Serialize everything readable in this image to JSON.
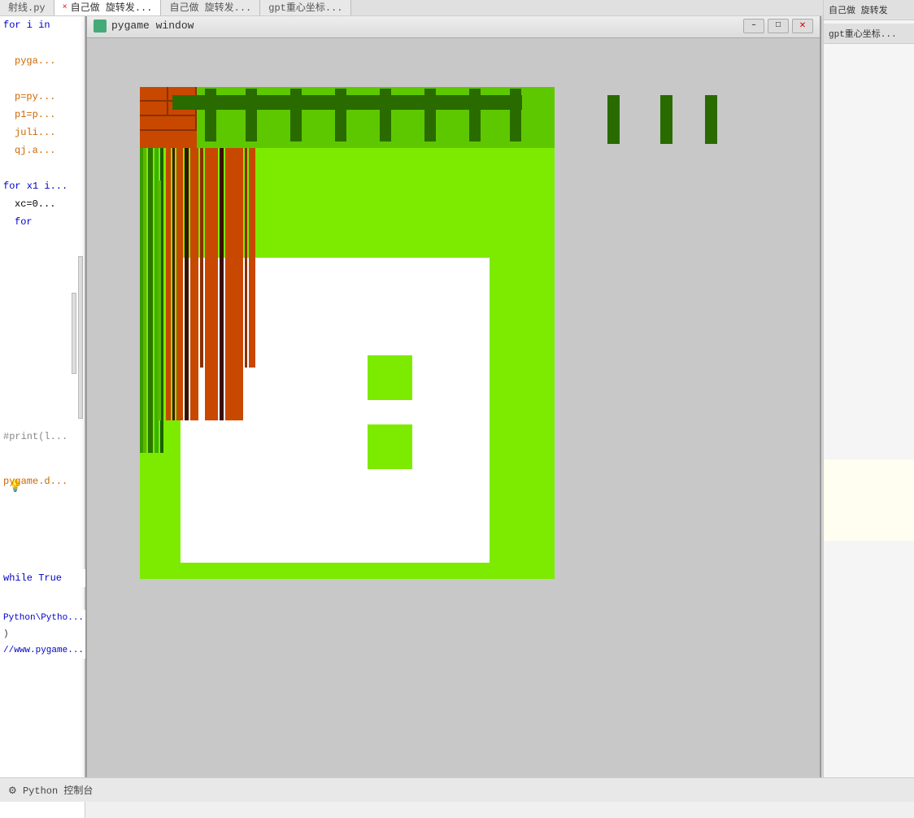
{
  "window": {
    "title": "pygame window",
    "minimize_label": "–",
    "restore_label": "□",
    "close_label": "✕"
  },
  "tabs": {
    "items": [
      {
        "label": "射线.py",
        "active": false
      },
      {
        "label": "× 自己做 旋转发...",
        "active": true
      },
      {
        "label": "自己做 旋转发..."
      },
      {
        "label": "gpt重心坐标..."
      }
    ]
  },
  "code": {
    "lines": [
      {
        "text": "for i in",
        "class": "code-blue",
        "indent": 0
      },
      {
        "text": "",
        "indent": 0
      },
      {
        "text": "pyga...",
        "class": "code-orange",
        "indent": 1
      },
      {
        "text": "",
        "indent": 0
      },
      {
        "text": "p=py...",
        "class": "code-orange",
        "indent": 1
      },
      {
        "text": "p1=p...",
        "class": "code-orange",
        "indent": 1
      },
      {
        "text": "juli...",
        "class": "code-orange",
        "indent": 1
      },
      {
        "text": "qj.a...",
        "class": "code-orange",
        "indent": 1
      },
      {
        "text": "",
        "indent": 0
      },
      {
        "text": "for x1 i...",
        "class": "code-blue",
        "indent": 0
      },
      {
        "text": "xc=0...",
        "class": "code-black",
        "indent": 1
      },
      {
        "text": "for",
        "class": "code-blue",
        "indent": 1
      }
    ]
  },
  "while_true": {
    "text": "while True"
  },
  "console": {
    "lines": [
      "Python\\Pytho...",
      ")",
      "//www.pygame..."
    ]
  },
  "bottom_bar": {
    "python_label": "⚙ Python 控制台"
  },
  "colors": {
    "bright_green": "#7deb00",
    "dark_green": "#2a6b00",
    "fence_green": "#5dc800",
    "brick_orange": "#c84800",
    "brick_dark": "#8b3000",
    "stripe_green": "#3a8c00",
    "stripe_dark": "#1a4000"
  }
}
